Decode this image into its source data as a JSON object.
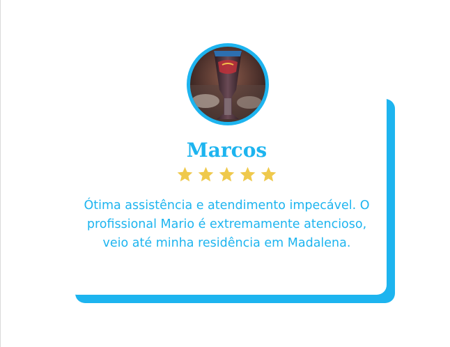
{
  "testimonial": {
    "name": "Marcos",
    "rating": 5,
    "rating_max": 5,
    "review_lines": [
      "Ótima assistência e atendimento impecável. O",
      "profissional Mario é extremamente atencioso,",
      "veio até minha residência em Madalena."
    ],
    "avatar_icon": "avatar-photo"
  },
  "colors": {
    "accent": "#1db4ef",
    "star": "#efc94c",
    "card_background": "#ffffff"
  }
}
